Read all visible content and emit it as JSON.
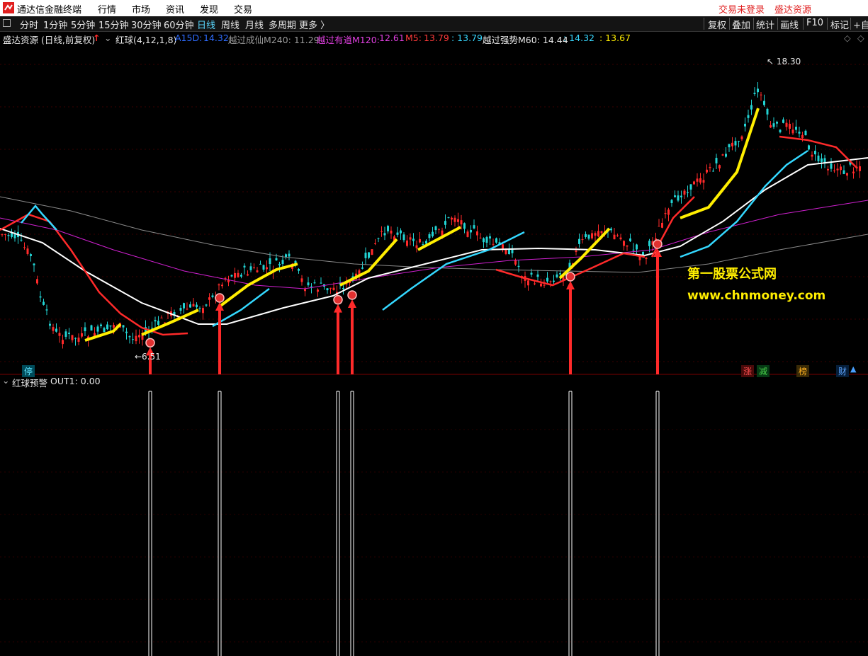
{
  "app": {
    "title": "通达信金融终端"
  },
  "menu": [
    "行情",
    "市场",
    "资讯",
    "发现",
    "交易"
  ],
  "menu_right": [
    "交易未登录",
    "盛达资源"
  ],
  "periods": [
    "分时",
    "1分钟",
    "5分钟",
    "15分钟",
    "30分钟",
    "60分钟",
    "日线",
    "周线",
    "月线",
    "多周期",
    "更多 〉"
  ],
  "active_period": "日线",
  "toolbar_right": [
    "复权",
    "叠加",
    "统计",
    "画线",
    "F10",
    "标记",
    "+自"
  ],
  "chart_info": {
    "stock": "盛达资源 (日线,前复权)",
    "indicator": "红球(4,12,1,8)",
    "a15d_label": "A15D:",
    "a15d_value": "14.32",
    "m240": "越过成仙M240: 11.29",
    "m120_label": "越过有道M120:",
    "m120_value": "12.61",
    "m5_label": "M5:",
    "m5_value": "13.79",
    "v1": ": 13.79",
    "m60": "越过强势M60: 14.44",
    "v2": ": 14.32",
    "v3": ": 13.67"
  },
  "price_marks": {
    "high": "18.30",
    "low": "6.51"
  },
  "watermark": {
    "line1": "第一股票公式网",
    "line2": "www.chnmoney.com"
  },
  "badges": {
    "left": "停",
    "right": [
      "涨",
      "减",
      "榜",
      "财"
    ]
  },
  "sub_indicator": {
    "name": "红球预警",
    "out": "OUT1: 0.00"
  },
  "colors": {
    "up": "#ff2a2a",
    "down": "#22d4d4",
    "ma_white": "#ffffff",
    "ma_magenta": "#d020d0",
    "ma_gray": "#8a8a8a",
    "yellow": "#ffee00",
    "cyan": "#34d8ff"
  },
  "chart_data": {
    "type": "line",
    "title": "",
    "price_range": [
      6.51,
      18.3
    ],
    "signal_days": [
      212,
      310,
      477,
      497,
      805,
      928
    ],
    "series": [
      {
        "name": "M240",
        "values": [
          11.29
        ]
      },
      {
        "name": "M120",
        "values": [
          12.61
        ]
      },
      {
        "name": "M5",
        "values": [
          13.79
        ]
      },
      {
        "name": "M60",
        "values": [
          14.44
        ]
      }
    ]
  }
}
